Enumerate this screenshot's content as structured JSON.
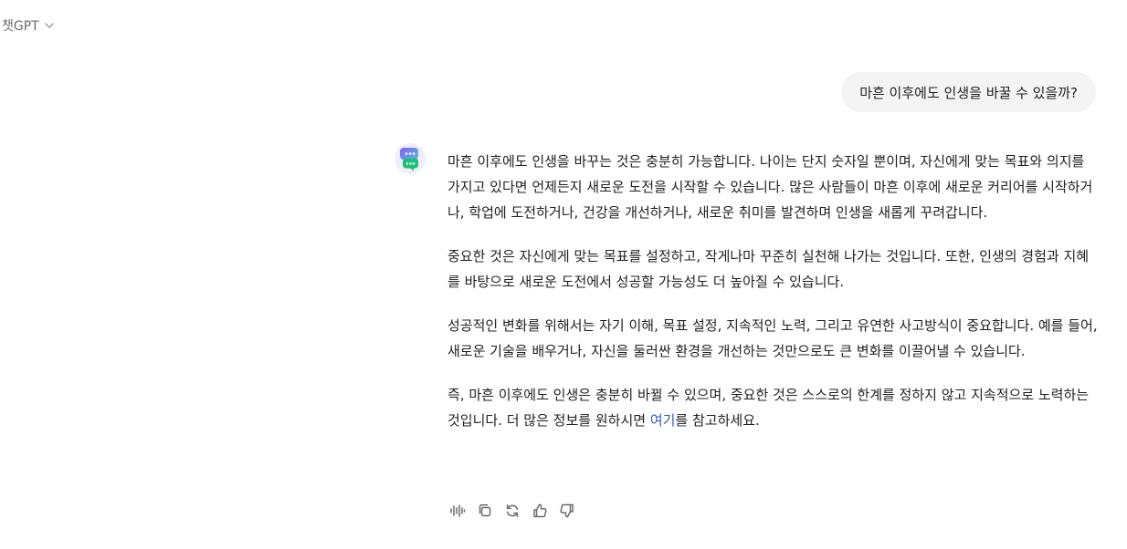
{
  "header": {
    "model_label": "챗GPT",
    "chevron_icon": "chevron-down-icon"
  },
  "conversation": {
    "user_message": "마흔 이후에도 인생을 바꿀 수 있을까?",
    "assistant": {
      "avatar_icon": "chat-bubbles-avatar-icon",
      "paragraphs": [
        "마흔 이후에도 인생을 바꾸는 것은 충분히 가능합니다. 나이는 단지 숫자일 뿐이며, 자신에게 맞는 목표와 의지를 가지고 있다면 언제든지 새로운 도전을 시작할 수 있습니다. 많은 사람들이 마흔 이후에 새로운 커리어를 시작하거나, 학업에 도전하거나, 건강을 개선하거나, 새로운 취미를 발견하며 인생을 새롭게 꾸려갑니다.",
        "중요한 것은 자신에게 맞는 목표를 설정하고, 작게나마 꾸준히 실천해 나가는 것입니다. 또한, 인생의 경험과 지혜를 바탕으로 새로운 도전에서 성공할 가능성도 더 높아질 수 있습니다.",
        "성공적인 변화를 위해서는 자기 이해, 목표 설정, 지속적인 노력, 그리고 유연한 사고방식이 중요합니다. 예를 들어, 새로운 기술을 배우거나, 자신을 둘러싼 환경을 개선하는 것만으로도 큰 변화를 이끌어낼 수 있습니다."
      ],
      "last_paragraph_before_link": "즉, 마흔 이후에도 인생은 충분히 바뀔 수 있으며, 중요한 것은 스스로의 한계를 정하지 않고 지속적으로 노력하는 것입니다. 더 많은 정보를 원하시면 ",
      "link_text": "여기",
      "last_paragraph_after_link": "를 참고하세요."
    }
  },
  "actions": [
    {
      "name": "read-aloud-button",
      "icon": "audio-waveform-icon"
    },
    {
      "name": "copy-button",
      "icon": "copy-icon"
    },
    {
      "name": "regenerate-button",
      "icon": "refresh-icon"
    },
    {
      "name": "thumbs-up-button",
      "icon": "thumbs-up-icon"
    },
    {
      "name": "thumbs-down-button",
      "icon": "thumbs-down-icon"
    }
  ],
  "colors": {
    "user_bubble_bg": "#f4f4f4",
    "link": "#2b5ec4",
    "muted": "#6b6b6b"
  }
}
